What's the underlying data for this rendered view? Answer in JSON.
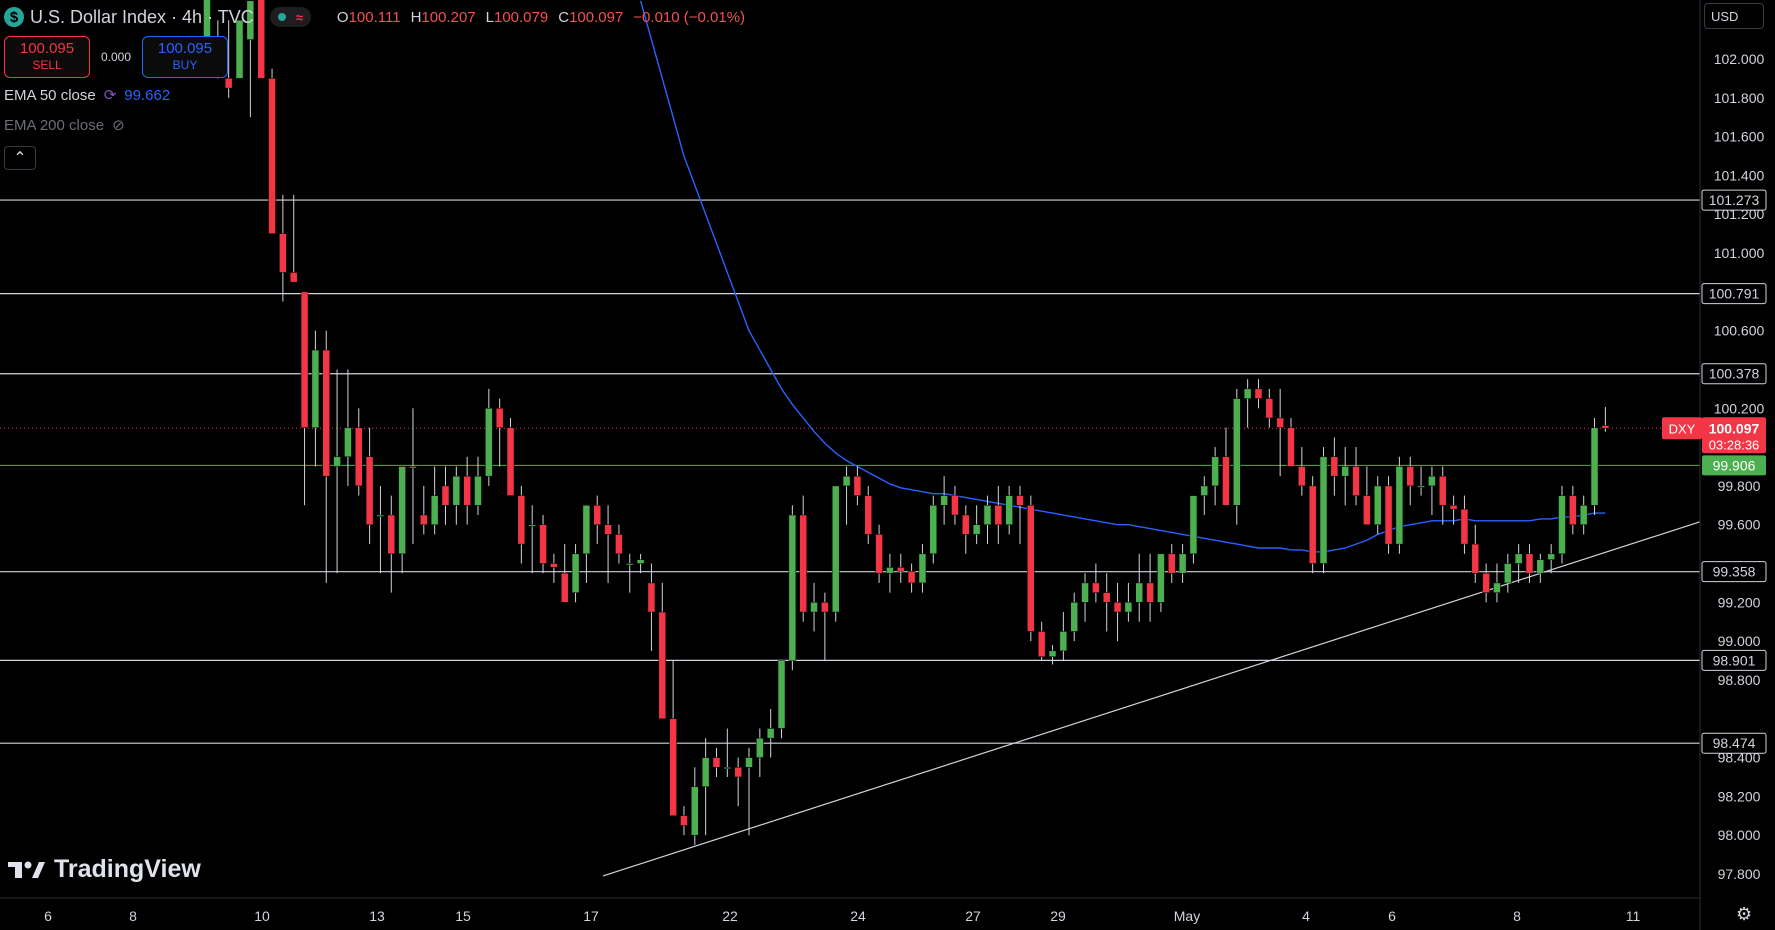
{
  "header": {
    "symbol_icon": "dollar-icon",
    "title": "U.S. Dollar Index · 4h · TVC",
    "ohlc": [
      {
        "k": "O",
        "v": "100.111"
      },
      {
        "k": "H",
        "v": "100.207"
      },
      {
        "k": "L",
        "v": "100.079"
      },
      {
        "k": "C",
        "v": "100.097"
      },
      {
        "k": "",
        "v": "−0.010 (−0.01%)"
      }
    ]
  },
  "trade": {
    "sell_price": "100.095",
    "sell_label": "SELL",
    "spread": "0.000",
    "buy_price": "100.095",
    "buy_label": "BUY"
  },
  "indicators": {
    "ema50_label": "EMA 50 close",
    "ema50_value": "99.662",
    "ema200_label": "EMA 200 close"
  },
  "currency": "USD",
  "brand": "TradingView",
  "colors": {
    "up": "#26a69a",
    "up_bright": "#4caf50",
    "down": "#f23645",
    "ema50": "#2962ff",
    "level": "#d1d4dc",
    "support": "#4caf50"
  },
  "chart_data": {
    "type": "candlestick",
    "title": "U.S. Dollar Index · 4h · TVC",
    "ylim": [
      97.7,
      102.2
    ],
    "y_ticks": [
      "102.000",
      "101.800",
      "101.600",
      "101.400",
      "101.200",
      "101.000",
      "100.600",
      "100.200",
      "99.800",
      "99.600",
      "99.200",
      "99.000",
      "98.800",
      "98.400",
      "98.200",
      "98.000",
      "97.800"
    ],
    "x_ticks": [
      "6",
      "8",
      "10",
      "13",
      "15",
      "17",
      "22",
      "24",
      "27",
      "29",
      "May",
      "4",
      "6",
      "8",
      "11"
    ],
    "horizontal_levels": [
      "101.273",
      "100.791",
      "100.378",
      "99.358",
      "98.901",
      "98.474"
    ],
    "support_level": "99.906",
    "current": {
      "symbol": "DXY",
      "price": "100.097",
      "countdown": "03:28:36"
    },
    "ema50_last": "99.662",
    "candles": [
      {
        "o": 102.05,
        "h": 102.25,
        "l": 101.95,
        "c": 102.35
      },
      {
        "o": 102.0,
        "h": 102.2,
        "l": 101.9,
        "c": 102.1
      },
      {
        "o": 101.9,
        "h": 102.2,
        "l": 101.8,
        "c": 101.85
      },
      {
        "o": 101.9,
        "h": 102.2,
        "l": 101.9,
        "c": 102.2
      },
      {
        "o": 102.1,
        "h": 102.2,
        "l": 101.7,
        "c": 102.3
      },
      {
        "o": 102.5,
        "h": 102.6,
        "l": 101.9,
        "c": 101.9
      },
      {
        "o": 101.9,
        "h": 101.95,
        "l": 101.1,
        "c": 101.1
      },
      {
        "o": 101.1,
        "h": 101.3,
        "l": 100.75,
        "c": 100.9
      },
      {
        "o": 100.9,
        "h": 101.3,
        "l": 100.85,
        "c": 100.85
      },
      {
        "o": 100.8,
        "h": 100.8,
        "l": 99.7,
        "c": 100.1
      },
      {
        "o": 100.1,
        "h": 100.6,
        "l": 99.9,
        "c": 100.5
      },
      {
        "o": 100.5,
        "h": 100.6,
        "l": 99.3,
        "c": 99.85
      },
      {
        "o": 99.9,
        "h": 100.4,
        "l": 99.35,
        "c": 99.95
      },
      {
        "o": 99.95,
        "h": 100.4,
        "l": 99.8,
        "c": 100.1
      },
      {
        "o": 100.1,
        "h": 100.2,
        "l": 99.75,
        "c": 99.8
      },
      {
        "o": 99.95,
        "h": 100.1,
        "l": 99.5,
        "c": 99.6
      },
      {
        "o": 99.65,
        "h": 99.8,
        "l": 99.35,
        "c": 99.65
      },
      {
        "o": 99.65,
        "h": 99.75,
        "l": 99.25,
        "c": 99.45
      },
      {
        "o": 99.45,
        "h": 99.9,
        "l": 99.35,
        "c": 99.9
      },
      {
        "o": 99.9,
        "h": 100.2,
        "l": 99.5,
        "c": 99.9
      },
      {
        "o": 99.65,
        "h": 99.8,
        "l": 99.55,
        "c": 99.6
      },
      {
        "o": 99.6,
        "h": 99.9,
        "l": 99.55,
        "c": 99.75
      },
      {
        "o": 99.8,
        "h": 99.9,
        "l": 99.6,
        "c": 99.7
      },
      {
        "o": 99.7,
        "h": 99.9,
        "l": 99.6,
        "c": 99.85
      },
      {
        "o": 99.85,
        "h": 99.95,
        "l": 99.6,
        "c": 99.7
      },
      {
        "o": 99.7,
        "h": 99.95,
        "l": 99.65,
        "c": 99.85
      },
      {
        "o": 99.85,
        "h": 100.3,
        "l": 99.8,
        "c": 100.2
      },
      {
        "o": 100.2,
        "h": 100.25,
        "l": 99.9,
        "c": 100.1
      },
      {
        "o": 100.1,
        "h": 100.15,
        "l": 99.8,
        "c": 99.75
      },
      {
        "o": 99.75,
        "h": 99.8,
        "l": 99.4,
        "c": 99.5
      },
      {
        "o": 99.6,
        "h": 99.7,
        "l": 99.35,
        "c": 99.6
      },
      {
        "o": 99.6,
        "h": 99.65,
        "l": 99.35,
        "c": 99.4
      },
      {
        "o": 99.4,
        "h": 99.45,
        "l": 99.3,
        "c": 99.38
      },
      {
        "o": 99.35,
        "h": 99.5,
        "l": 99.2,
        "c": 99.2
      },
      {
        "o": 99.25,
        "h": 99.5,
        "l": 99.2,
        "c": 99.45
      },
      {
        "o": 99.45,
        "h": 99.7,
        "l": 99.3,
        "c": 99.7
      },
      {
        "o": 99.7,
        "h": 99.75,
        "l": 99.5,
        "c": 99.6
      },
      {
        "o": 99.6,
        "h": 99.7,
        "l": 99.3,
        "c": 99.55
      },
      {
        "o": 99.55,
        "h": 99.6,
        "l": 99.4,
        "c": 99.45
      },
      {
        "o": 99.4,
        "h": 99.45,
        "l": 99.25,
        "c": 99.4
      },
      {
        "o": 99.4,
        "h": 99.45,
        "l": 99.35,
        "c": 99.42
      },
      {
        "o": 99.3,
        "h": 99.4,
        "l": 98.95,
        "c": 99.15
      },
      {
        "o": 99.15,
        "h": 99.3,
        "l": 98.6,
        "c": 98.6
      },
      {
        "o": 98.6,
        "h": 98.9,
        "l": 98.1,
        "c": 98.1
      },
      {
        "o": 98.1,
        "h": 98.15,
        "l": 98.0,
        "c": 98.05
      },
      {
        "o": 98.0,
        "h": 98.35,
        "l": 97.95,
        "c": 98.25
      },
      {
        "o": 98.25,
        "h": 98.5,
        "l": 98.0,
        "c": 98.4
      },
      {
        "o": 98.4,
        "h": 98.45,
        "l": 98.3,
        "c": 98.35
      },
      {
        "o": 98.35,
        "h": 98.55,
        "l": 98.3,
        "c": 98.35
      },
      {
        "o": 98.35,
        "h": 98.4,
        "l": 98.15,
        "c": 98.3
      },
      {
        "o": 98.35,
        "h": 98.45,
        "l": 98.0,
        "c": 98.4
      },
      {
        "o": 98.4,
        "h": 98.55,
        "l": 98.3,
        "c": 98.5
      },
      {
        "o": 98.5,
        "h": 98.65,
        "l": 98.4,
        "c": 98.55
      },
      {
        "o": 98.55,
        "h": 98.9,
        "l": 98.5,
        "c": 98.9
      },
      {
        "o": 98.9,
        "h": 99.7,
        "l": 98.85,
        "c": 99.65
      },
      {
        "o": 99.65,
        "h": 99.75,
        "l": 99.1,
        "c": 99.15
      },
      {
        "o": 99.15,
        "h": 99.3,
        "l": 99.05,
        "c": 99.2
      },
      {
        "o": 99.2,
        "h": 99.25,
        "l": 98.9,
        "c": 99.15
      },
      {
        "o": 99.15,
        "h": 99.8,
        "l": 99.1,
        "c": 99.8
      },
      {
        "o": 99.8,
        "h": 99.9,
        "l": 99.6,
        "c": 99.85
      },
      {
        "o": 99.85,
        "h": 99.9,
        "l": 99.7,
        "c": 99.75
      },
      {
        "o": 99.75,
        "h": 99.8,
        "l": 99.5,
        "c": 99.55
      },
      {
        "o": 99.55,
        "h": 99.6,
        "l": 99.3,
        "c": 99.35
      },
      {
        "o": 99.35,
        "h": 99.45,
        "l": 99.25,
        "c": 99.38
      },
      {
        "o": 99.38,
        "h": 99.45,
        "l": 99.3,
        "c": 99.36
      },
      {
        "o": 99.36,
        "h": 99.4,
        "l": 99.25,
        "c": 99.3
      },
      {
        "o": 99.3,
        "h": 99.5,
        "l": 99.25,
        "c": 99.45
      },
      {
        "o": 99.45,
        "h": 99.75,
        "l": 99.4,
        "c": 99.7
      },
      {
        "o": 99.7,
        "h": 99.85,
        "l": 99.6,
        "c": 99.75
      },
      {
        "o": 99.75,
        "h": 99.8,
        "l": 99.6,
        "c": 99.65
      },
      {
        "o": 99.65,
        "h": 99.7,
        "l": 99.45,
        "c": 99.55
      },
      {
        "o": 99.55,
        "h": 99.7,
        "l": 99.5,
        "c": 99.6
      },
      {
        "o": 99.6,
        "h": 99.75,
        "l": 99.5,
        "c": 99.7
      },
      {
        "o": 99.7,
        "h": 99.8,
        "l": 99.5,
        "c": 99.6
      },
      {
        "o": 99.6,
        "h": 99.8,
        "l": 99.55,
        "c": 99.75
      },
      {
        "o": 99.75,
        "h": 99.8,
        "l": 99.5,
        "c": 99.7
      },
      {
        "o": 99.7,
        "h": 99.75,
        "l": 99.0,
        "c": 99.05
      },
      {
        "o": 99.05,
        "h": 99.1,
        "l": 98.9,
        "c": 98.92
      },
      {
        "o": 98.92,
        "h": 98.98,
        "l": 98.88,
        "c": 98.95
      },
      {
        "o": 98.95,
        "h": 99.15,
        "l": 98.9,
        "c": 99.05
      },
      {
        "o": 99.05,
        "h": 99.25,
        "l": 99.0,
        "c": 99.2
      },
      {
        "o": 99.2,
        "h": 99.35,
        "l": 99.1,
        "c": 99.3
      },
      {
        "o": 99.3,
        "h": 99.4,
        "l": 99.2,
        "c": 99.25
      },
      {
        "o": 99.25,
        "h": 99.35,
        "l": 99.05,
        "c": 99.2
      },
      {
        "o": 99.2,
        "h": 99.3,
        "l": 99.0,
        "c": 99.15
      },
      {
        "o": 99.15,
        "h": 99.3,
        "l": 99.1,
        "c": 99.2
      },
      {
        "o": 99.2,
        "h": 99.45,
        "l": 99.1,
        "c": 99.3
      },
      {
        "o": 99.3,
        "h": 99.45,
        "l": 99.1,
        "c": 99.2
      },
      {
        "o": 99.2,
        "h": 99.45,
        "l": 99.15,
        "c": 99.45
      },
      {
        "o": 99.45,
        "h": 99.5,
        "l": 99.3,
        "c": 99.35
      },
      {
        "o": 99.35,
        "h": 99.5,
        "l": 99.3,
        "c": 99.45
      },
      {
        "o": 99.45,
        "h": 99.75,
        "l": 99.4,
        "c": 99.75
      },
      {
        "o": 99.75,
        "h": 99.85,
        "l": 99.65,
        "c": 99.8
      },
      {
        "o": 99.8,
        "h": 100.0,
        "l": 99.7,
        "c": 99.95
      },
      {
        "o": 99.95,
        "h": 100.1,
        "l": 99.7,
        "c": 99.7
      },
      {
        "o": 99.7,
        "h": 100.3,
        "l": 99.6,
        "c": 100.25
      },
      {
        "o": 100.25,
        "h": 100.35,
        "l": 100.1,
        "c": 100.3
      },
      {
        "o": 100.3,
        "h": 100.35,
        "l": 100.2,
        "c": 100.25
      },
      {
        "o": 100.25,
        "h": 100.3,
        "l": 100.1,
        "c": 100.15
      },
      {
        "o": 100.15,
        "h": 100.3,
        "l": 99.85,
        "c": 100.1
      },
      {
        "o": 100.1,
        "h": 100.15,
        "l": 99.9,
        "c": 99.9
      },
      {
        "o": 99.9,
        "h": 100.0,
        "l": 99.75,
        "c": 99.8
      },
      {
        "o": 99.8,
        "h": 99.85,
        "l": 99.35,
        "c": 99.4
      },
      {
        "o": 99.4,
        "h": 100.0,
        "l": 99.35,
        "c": 99.95
      },
      {
        "o": 99.95,
        "h": 100.05,
        "l": 99.75,
        "c": 99.85
      },
      {
        "o": 99.85,
        "h": 100.0,
        "l": 99.7,
        "c": 99.9
      },
      {
        "o": 99.9,
        "h": 100.0,
        "l": 99.7,
        "c": 99.75
      },
      {
        "o": 99.75,
        "h": 99.9,
        "l": 99.6,
        "c": 99.6
      },
      {
        "o": 99.6,
        "h": 99.85,
        "l": 99.55,
        "c": 99.8
      },
      {
        "o": 99.8,
        "h": 99.85,
        "l": 99.45,
        "c": 99.5
      },
      {
        "o": 99.5,
        "h": 99.95,
        "l": 99.45,
        "c": 99.9
      },
      {
        "o": 99.9,
        "h": 99.95,
        "l": 99.7,
        "c": 99.8
      },
      {
        "o": 99.8,
        "h": 99.9,
        "l": 99.75,
        "c": 99.8
      },
      {
        "o": 99.8,
        "h": 99.9,
        "l": 99.65,
        "c": 99.85
      },
      {
        "o": 99.85,
        "h": 99.9,
        "l": 99.6,
        "c": 99.7
      },
      {
        "o": 99.7,
        "h": 99.75,
        "l": 99.6,
        "c": 99.68
      },
      {
        "o": 99.68,
        "h": 99.75,
        "l": 99.45,
        "c": 99.5
      },
      {
        "o": 99.5,
        "h": 99.6,
        "l": 99.3,
        "c": 99.35
      },
      {
        "o": 99.35,
        "h": 99.4,
        "l": 99.2,
        "c": 99.25
      },
      {
        "o": 99.25,
        "h": 99.4,
        "l": 99.2,
        "c": 99.3
      },
      {
        "o": 99.3,
        "h": 99.45,
        "l": 99.25,
        "c": 99.4
      },
      {
        "o": 99.4,
        "h": 99.5,
        "l": 99.3,
        "c": 99.45
      },
      {
        "o": 99.45,
        "h": 99.5,
        "l": 99.3,
        "c": 99.35
      },
      {
        "o": 99.35,
        "h": 99.45,
        "l": 99.3,
        "c": 99.42
      },
      {
        "o": 99.42,
        "h": 99.5,
        "l": 99.35,
        "c": 99.45
      },
      {
        "o": 99.45,
        "h": 99.8,
        "l": 99.4,
        "c": 99.75
      },
      {
        "o": 99.75,
        "h": 99.8,
        "l": 99.55,
        "c": 99.6
      },
      {
        "o": 99.6,
        "h": 99.75,
        "l": 99.55,
        "c": 99.7
      },
      {
        "o": 99.7,
        "h": 100.15,
        "l": 99.65,
        "c": 100.1
      },
      {
        "o": 100.111,
        "h": 100.207,
        "l": 100.079,
        "c": 100.097
      }
    ],
    "ema50": [
      102.3,
      102.1,
      101.9,
      101.7,
      101.5,
      101.35,
      101.2,
      101.05,
      100.9,
      100.75,
      100.6,
      100.5,
      100.4,
      100.3,
      100.22,
      100.15,
      100.08,
      100.02,
      99.97,
      99.93,
      99.9,
      99.87,
      99.84,
      99.81,
      99.79,
      99.78,
      99.77,
      99.76,
      99.76,
      99.75,
      99.74,
      99.73,
      99.72,
      99.71,
      99.7,
      99.69,
      99.68,
      99.67,
      99.66,
      99.65,
      99.64,
      99.63,
      99.62,
      99.61,
      99.6,
      99.6,
      99.59,
      99.58,
      99.57,
      99.56,
      99.55,
      99.54,
      99.53,
      99.52,
      99.51,
      99.5,
      99.49,
      99.48,
      99.48,
      99.48,
      99.47,
      99.47,
      99.46,
      99.46,
      99.47,
      99.48,
      99.5,
      99.52,
      99.55,
      99.57,
      99.59,
      99.6,
      99.61,
      99.62,
      99.62,
      99.62,
      99.63,
      99.62,
      99.62,
      99.62,
      99.62,
      99.62,
      99.62,
      99.63,
      99.63,
      99.64,
      99.64,
      99.65,
      99.66,
      99.66
    ]
  }
}
